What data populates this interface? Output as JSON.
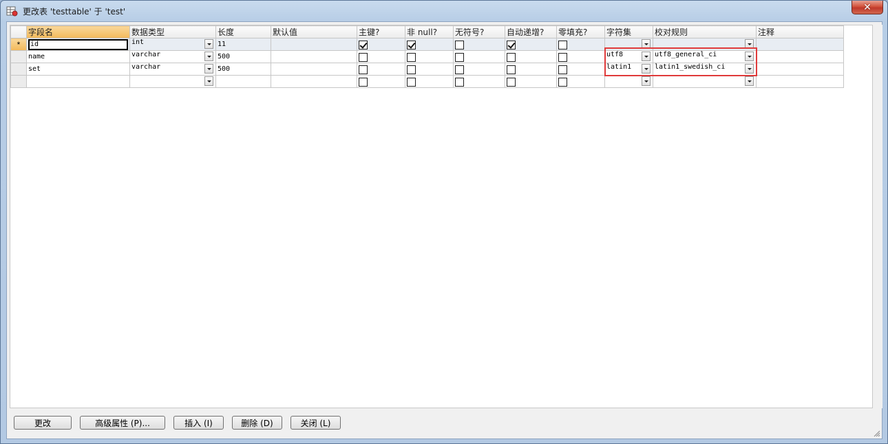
{
  "window": {
    "title": "更改表 'testtable' 于 'test'",
    "close_glyph": "✕"
  },
  "grid": {
    "columns": [
      "字段名",
      "数据类型",
      "长度",
      "默认值",
      "主键?",
      "非 null?",
      "无符号?",
      "自动递增?",
      "零填充?",
      "字符集",
      "校对规则",
      "注释"
    ],
    "active_row_marker": "*",
    "rows": [
      {
        "name": "id",
        "type": "int",
        "length": "11",
        "default": "",
        "pk": true,
        "not_null": true,
        "unsigned": false,
        "auto_inc": true,
        "zerofill": false,
        "charset": "",
        "collation": "",
        "comment": ""
      },
      {
        "name": "name",
        "type": "varchar",
        "length": "500",
        "default": "",
        "pk": false,
        "not_null": false,
        "unsigned": false,
        "auto_inc": false,
        "zerofill": false,
        "charset": "utf8",
        "collation": "utf8_general_ci",
        "comment": ""
      },
      {
        "name": "set",
        "type": "varchar",
        "length": "500",
        "default": "",
        "pk": false,
        "not_null": false,
        "unsigned": false,
        "auto_inc": false,
        "zerofill": false,
        "charset": "latin1",
        "collation": "latin1_swedish_ci",
        "comment": ""
      },
      {
        "name": "",
        "type": "",
        "length": "",
        "default": "",
        "pk": false,
        "not_null": false,
        "unsigned": false,
        "auto_inc": false,
        "zerofill": false,
        "charset": "",
        "collation": "",
        "comment": ""
      }
    ]
  },
  "buttons": {
    "alter": "更改",
    "advanced": "高级属性 (P)...",
    "insert": "插入 (I)",
    "delete": "删除 (D)",
    "close": "关闭 (L)"
  },
  "colors": {
    "highlight": "#e03a3a",
    "active_header": "#f3b95a"
  }
}
